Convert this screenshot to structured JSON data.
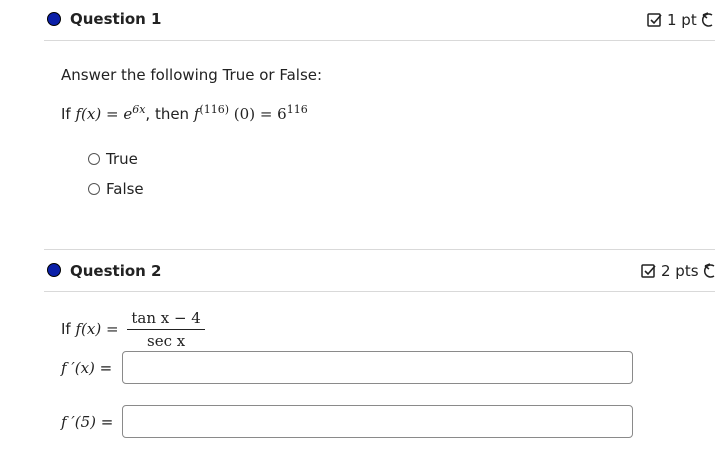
{
  "q1": {
    "title": "Question 1",
    "points": "1 pt",
    "prompt": "Answer the following True or False:",
    "statement": {
      "if": "If",
      "lhs": "f(x) = e",
      "exp": "6x",
      "then": ", then",
      "f": "f",
      "order": "(116)",
      "arg": "(0) = 6",
      "power": "116"
    },
    "options": [
      "True",
      "False"
    ]
  },
  "q2": {
    "title": "Question 2",
    "points": "2 pts",
    "if": "If",
    "func": "f(x) =",
    "numerator": "tan x − 4",
    "denominator": "sec x",
    "fields": [
      {
        "label_math": "f ′(x)",
        "eq": "=",
        "value": ""
      },
      {
        "label_math": "f ′(5)",
        "eq": "=",
        "value": ""
      }
    ]
  },
  "colors": {
    "bullet": "#0b1fa8",
    "divider": "#d9d9d9",
    "input_border": "#8a8a8a"
  },
  "icons": {
    "points": "checkbox-edit-icon",
    "undo": "undo-icon",
    "bullet": "status-dot-icon"
  }
}
